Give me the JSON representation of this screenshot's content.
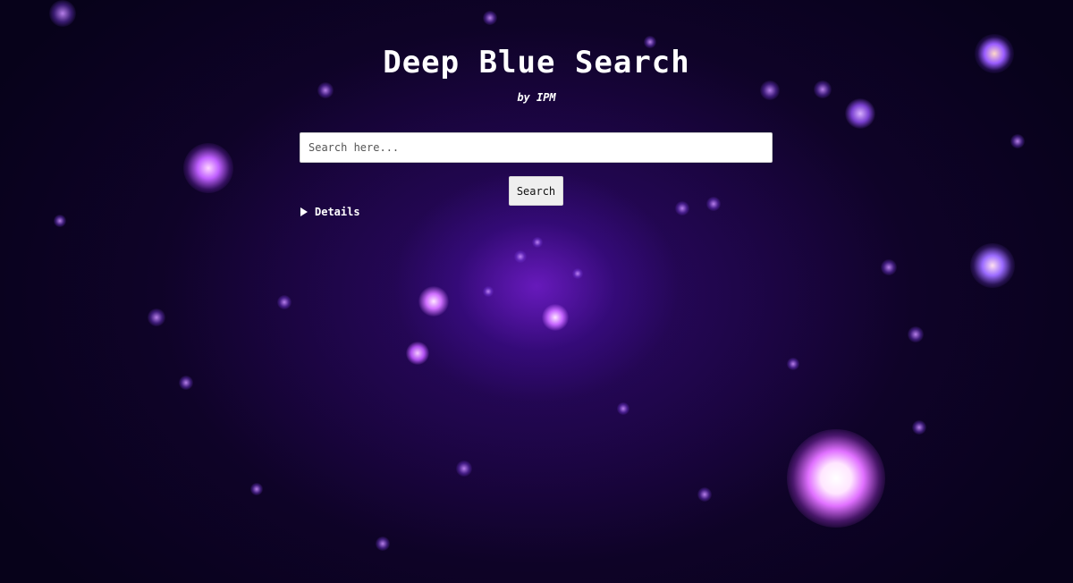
{
  "page": {
    "title": "Deep Blue Search",
    "subtitle": "by IPM"
  },
  "search": {
    "placeholder": "Search here...",
    "value": "",
    "button_label": "Search"
  },
  "details": {
    "label": "Details",
    "expanded": false
  },
  "background": {
    "image": "star-cluster-space",
    "colors": [
      "#07021a",
      "#1c0640",
      "#9628ff"
    ]
  }
}
